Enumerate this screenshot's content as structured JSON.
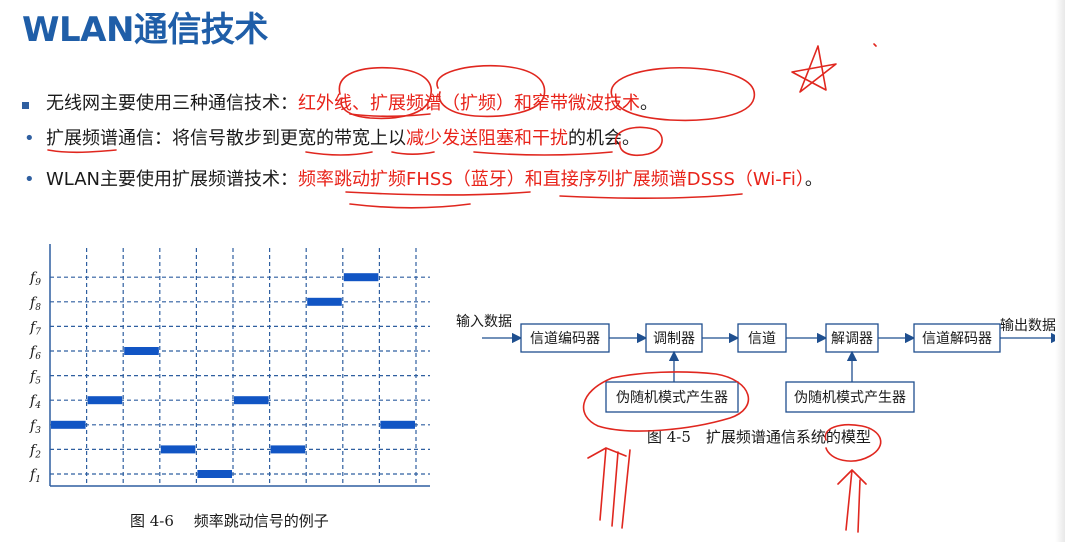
{
  "slide": {
    "title": "WLAN通信技术",
    "bullets": [
      {
        "marker": "square",
        "parts": [
          {
            "text": "无线网主要使用三种通信技术：",
            "red": false
          },
          {
            "text": "红外线、扩展频谱（扩频）和窄带微波技术",
            "red": true
          },
          {
            "text": "。",
            "red": false
          }
        ]
      },
      {
        "marker": "dot",
        "parts": [
          {
            "text": "扩展频谱通信：将信号散步到更宽的带宽上以",
            "red": false
          },
          {
            "text": "减少发送阻塞和干扰",
            "red": true
          },
          {
            "text": "的机会。",
            "red": false
          }
        ]
      },
      {
        "marker": "dot",
        "parts": [
          {
            "text": "WLAN主要使用扩展频谱技术：",
            "red": false
          },
          {
            "text": "频率跳动扩频FHSS（蓝牙）和直接序列扩展频谱DSSS（Wi-Fi）",
            "red": true
          },
          {
            "text": "。",
            "red": false
          }
        ]
      }
    ]
  },
  "figure_hopping": {
    "caption": "图 4-6　 频率跳动信号的例子",
    "freq_labels": [
      "f9",
      "f8",
      "f7",
      "f6",
      "f5",
      "f4",
      "f3",
      "f2",
      "f1"
    ],
    "hops": [
      3,
      4,
      6,
      2,
      1,
      4,
      2,
      8,
      9,
      3
    ],
    "bar_color": "#1155c4",
    "grid_color": "#2f5fa0"
  },
  "figure_system": {
    "caption": "图 4-5　扩展频谱通信系统的模型",
    "input_label": "输入数据",
    "output_label": "输出数据",
    "blocks": [
      "信道编码器",
      "调制器",
      "信道",
      "解调器",
      "信道解码器"
    ],
    "generator_left": "伪随机模式产生器",
    "generator_right": "伪随机模式产生器"
  },
  "colors": {
    "title": "#1f5ea8",
    "emphasis": "#e8231a",
    "annotation_ink": "#e0271f"
  }
}
